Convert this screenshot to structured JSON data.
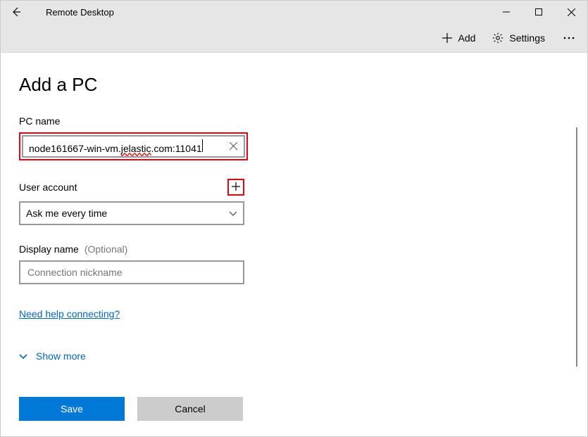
{
  "window": {
    "title": "Remote Desktop"
  },
  "toolbar": {
    "add_label": "Add",
    "settings_label": "Settings"
  },
  "page": {
    "heading": "Add a PC",
    "pc_name_label": "PC name",
    "pc_name_value_part1": "node161667-win-vm.",
    "pc_name_value_spell": "jelastic",
    "pc_name_value_part2": ".com:11041",
    "user_account_label": "User account",
    "user_account_selected": "Ask me every time",
    "display_name_label": "Display name",
    "display_name_optional": "(Optional)",
    "display_name_placeholder": "Connection nickname",
    "help_link": "Need help connecting?",
    "show_more_label": "Show more",
    "save_label": "Save",
    "cancel_label": "Cancel"
  }
}
